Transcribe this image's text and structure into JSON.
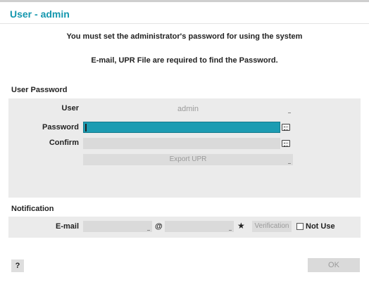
{
  "dialog": {
    "title": "User - admin",
    "message_line1": "You must set the administrator's password for using the system",
    "message_line2": "E-mail, UPR File are required to find the Password."
  },
  "user_password": {
    "section_label": "User Password",
    "user_label": "User",
    "user_value": "admin",
    "password_label": "Password",
    "password_value": "",
    "confirm_label": "Confirm",
    "confirm_value": "",
    "export_upr_label": "Export UPR"
  },
  "notification": {
    "section_label": "Notification",
    "email_label": "E-mail",
    "email_user_value": "",
    "at_symbol": "@",
    "email_domain_value": "",
    "star_symbol": "★",
    "verification_label": "Verification",
    "not_use_label": "Not Use",
    "not_use_checked": false
  },
  "footer": {
    "help_label": "?",
    "ok_label": "OK"
  },
  "colors": {
    "accent": "#1497ae",
    "active_field": "#1d9cb2",
    "panel_bg": "#ebebeb",
    "field_bg": "#dadada"
  },
  "icons": {
    "keyboard": "keyboard-icon",
    "star": "star-icon",
    "checkbox": "checkbox-icon"
  }
}
